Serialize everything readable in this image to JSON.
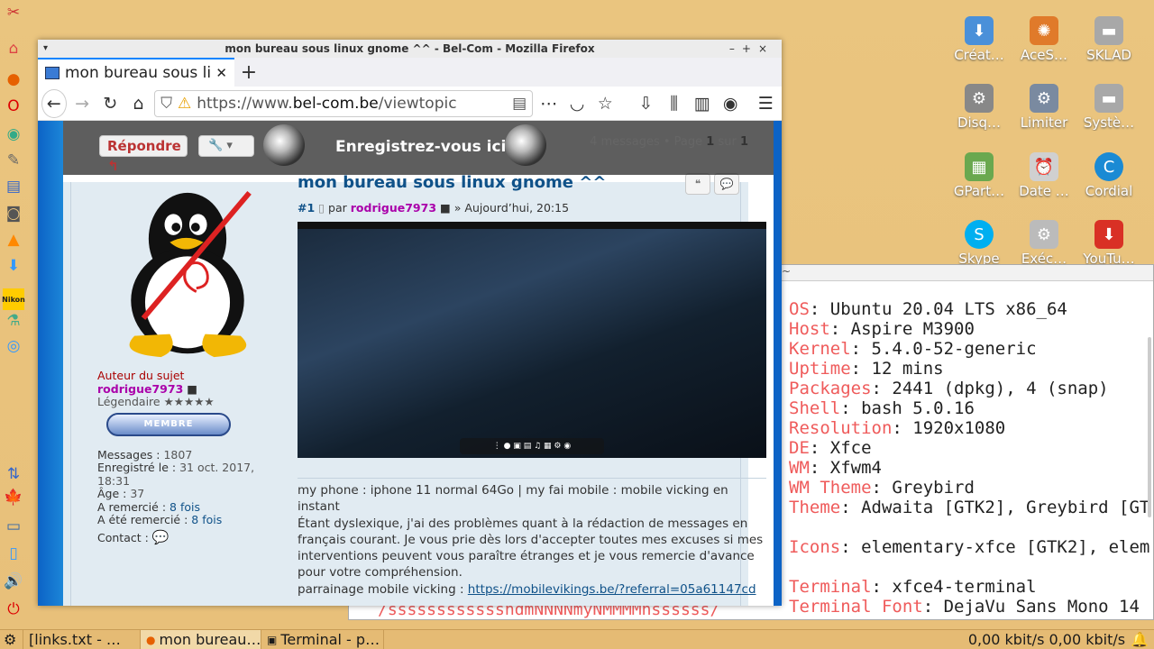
{
  "desktop_icons": [
    {
      "label": "Créat…",
      "icon": "create-launcher-icon",
      "color": "#4a90d9"
    },
    {
      "label": "AceS…",
      "icon": "aces-icon",
      "color": "#e07a2a"
    },
    {
      "label": "SKLAD",
      "icon": "drive-icon",
      "color": "#a8a8a8"
    },
    {
      "label": "Disq…",
      "icon": "disk-utility-icon",
      "color": "#888888"
    },
    {
      "label": "Limiter",
      "icon": "limiter-icon",
      "color": "#7a8aa0"
    },
    {
      "label": "Systè…",
      "icon": "system-drive-icon",
      "color": "#a8a8a8"
    },
    {
      "label": "GPart…",
      "icon": "gparted-icon",
      "color": "#6aa84f"
    },
    {
      "label": "Date …",
      "icon": "date-time-icon",
      "color": "#d0d0d0"
    },
    {
      "label": "Cordial",
      "icon": "cordial-icon",
      "color": "#1a8ad4"
    },
    {
      "label": "Skype",
      "icon": "skype-icon",
      "color": "#00aff0"
    },
    {
      "label": "Exéc…",
      "icon": "execute-icon",
      "color": "#bbbbbb"
    },
    {
      "label": "YouTu…",
      "icon": "youtube-download-icon",
      "color": "#d93025"
    }
  ],
  "firefox": {
    "window_title": "mon bureau sous linux gnome ^^ - Bel-Com - Mozilla Firefox",
    "tab_title": "mon bureau sous linux gnome ^^ - Bel-Com",
    "url_prefix": "https://www.",
    "url_domain": "bel-com.be",
    "url_path": "/viewtopic",
    "banner_text": "Enregistrez-vous ici !",
    "old_title": "mon bureau sous linux gnome",
    "reply_label": "Répondre",
    "pagination": {
      "text_pre": "4 messages • Page ",
      "page": "1",
      "text_mid": " sur ",
      "total": "1"
    },
    "post": {
      "title": "mon bureau sous linux gnome ^^",
      "number": "#1",
      "by": "par",
      "author": "rodrigue7973",
      "date": "» Aujourd’hui, 20:15",
      "profile": {
        "role": "Auteur du sujet",
        "username": "rodrigue7973",
        "rank": "Légendaire ★★★★★",
        "badge": "MEMBRE",
        "messages_label": "Messages :",
        "messages": "1807",
        "registered_label": "Enregistré le :",
        "registered": "31 oct. 2017, 18:31",
        "age_label": "Âge :",
        "age": "37",
        "thanked_label": "A remercié :",
        "thanked": "8 fois",
        "been_thanked_label": "A été remercié :",
        "been_thanked": "8 fois",
        "contact_label": "Contact :"
      },
      "signature": {
        "line1": "my phone : iphone 11 normal 64Go | my fai mobile : mobile vicking en instant",
        "line2": "Étant dyslexique, j'ai des problèmes quant à la rédaction de messages en français courant. Je vous prie dès lors d'accepter toutes mes excuses si mes interventions peuvent vous paraître étranges et je vous remercie d'avance pour votre compréhension.",
        "line3_label": "parrainage mobile vicking :",
        "line3_link": "https://mobilevikings.be/?referral=05a61147cd"
      }
    }
  },
  "terminal": {
    "lines": [
      {
        "k": "OS",
        "v": ": Ubuntu 20.04 LTS x86_64"
      },
      {
        "k": "Host",
        "v": ": Aspire M3900"
      },
      {
        "k": "Kernel",
        "v": ": 5.4.0-52-generic"
      },
      {
        "k": "Uptime",
        "v": ": 12 mins"
      },
      {
        "k": "Packages",
        "v": ": 2441 (dpkg), 4 (snap)"
      },
      {
        "k": "Shell",
        "v": ": bash 5.0.16"
      },
      {
        "k": "Resolution",
        "v": ": 1920x1080"
      },
      {
        "k": "DE",
        "v": ": Xfce"
      },
      {
        "k": "WM",
        "v": ": Xfwm4"
      },
      {
        "k": "WM Theme",
        "v": ": Greybird"
      },
      {
        "k": "Theme",
        "v": ": Adwaita [GTK2], Greybird [GT"
      },
      {
        "k": "",
        "v": ""
      },
      {
        "k": "Icons",
        "v": ": elementary-xfce [GTK2], elem"
      },
      {
        "k": "",
        "v": ""
      },
      {
        "k": "Terminal",
        "v": ": xfce4-terminal"
      },
      {
        "k": "Terminal Font",
        "v": ": DejaVu Sans Mono 14"
      }
    ],
    "ascii_tail": "/sssssssssssshdmNNNNmyNMMMMhssssss/"
  },
  "taskbar": {
    "items": [
      "[links.txt - …",
      "mon bureau…",
      "Terminal - p…"
    ],
    "net_down": "0,00 kbit/s",
    "net_up": "0,00 kbit/s"
  }
}
